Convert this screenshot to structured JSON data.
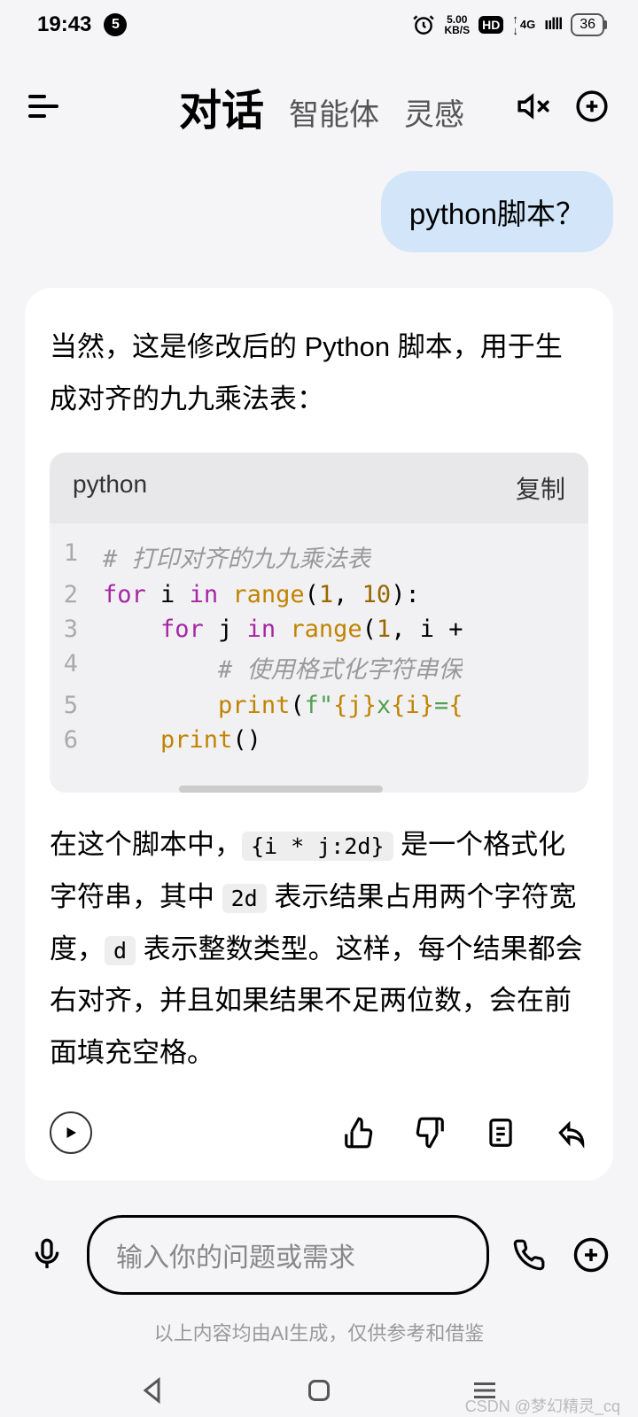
{
  "status": {
    "time": "19:43",
    "badge": "5",
    "speed_top": "5.00",
    "speed_bot": "KB/S",
    "hd": "HD",
    "net": "4G",
    "batt": "36"
  },
  "header": {
    "tab_active": "对话",
    "tab_agents": "智能体",
    "tab_inspire": "灵感"
  },
  "chat": {
    "user": "python脚本？",
    "ai_pre": "当然，这是修改后的 Python 脚本，用于生成对齐的九九乘法表：",
    "code_lang": "python",
    "copy": "复制",
    "lines": [
      {
        "n": "1",
        "seg": [
          {
            "c": "cm",
            "t": "# 打印对齐的九九乘法表"
          }
        ]
      },
      {
        "n": "2",
        "seg": [
          {
            "c": "kw",
            "t": "for"
          },
          {
            "c": "",
            "t": " i "
          },
          {
            "c": "kw",
            "t": "in"
          },
          {
            "c": "",
            "t": " "
          },
          {
            "c": "fn",
            "t": "range"
          },
          {
            "c": "",
            "t": "("
          },
          {
            "c": "nu",
            "t": "1"
          },
          {
            "c": "",
            "t": ", "
          },
          {
            "c": "nu",
            "t": "10"
          },
          {
            "c": "",
            "t": "):"
          }
        ]
      },
      {
        "n": "3",
        "seg": [
          {
            "c": "",
            "t": "    "
          },
          {
            "c": "kw",
            "t": "for"
          },
          {
            "c": "",
            "t": " j "
          },
          {
            "c": "kw",
            "t": "in"
          },
          {
            "c": "",
            "t": " "
          },
          {
            "c": "fn",
            "t": "range"
          },
          {
            "c": "",
            "t": "("
          },
          {
            "c": "nu",
            "t": "1"
          },
          {
            "c": "",
            "t": ", i +"
          }
        ]
      },
      {
        "n": "4",
        "seg": [
          {
            "c": "",
            "t": "        "
          },
          {
            "c": "cm",
            "t": "# 使用格式化字符串保"
          }
        ]
      },
      {
        "n": "5",
        "seg": [
          {
            "c": "",
            "t": "        "
          },
          {
            "c": "fn",
            "t": "print"
          },
          {
            "c": "",
            "t": "("
          },
          {
            "c": "st",
            "t": "f\""
          },
          {
            "c": "tp",
            "t": "{j}"
          },
          {
            "c": "st",
            "t": "x"
          },
          {
            "c": "tp",
            "t": "{i}"
          },
          {
            "c": "st",
            "t": "="
          },
          {
            "c": "tp",
            "t": "{"
          }
        ]
      },
      {
        "n": "6",
        "seg": [
          {
            "c": "",
            "t": "    "
          },
          {
            "c": "fn",
            "t": "print"
          },
          {
            "c": "",
            "t": "()"
          }
        ]
      }
    ],
    "ai_post_1": "在这个脚本中，",
    "ic1": "{i * j:2d}",
    "ai_post_2": " 是一个格式化字符串，其中 ",
    "ic2": "2d",
    "ai_post_3": " 表示结果占用两个字符宽度，",
    "ic3": "d",
    "ai_post_4": " 表示整数类型。这样，每个结果都会右对齐，并且如果结果不足两位数，会在前面填充空格。"
  },
  "input": {
    "placeholder": "输入你的问题或需求"
  },
  "disclaimer": "以上内容均由AI生成，仅供参考和借鉴",
  "watermark": "CSDN @梦幻精灵_cq"
}
